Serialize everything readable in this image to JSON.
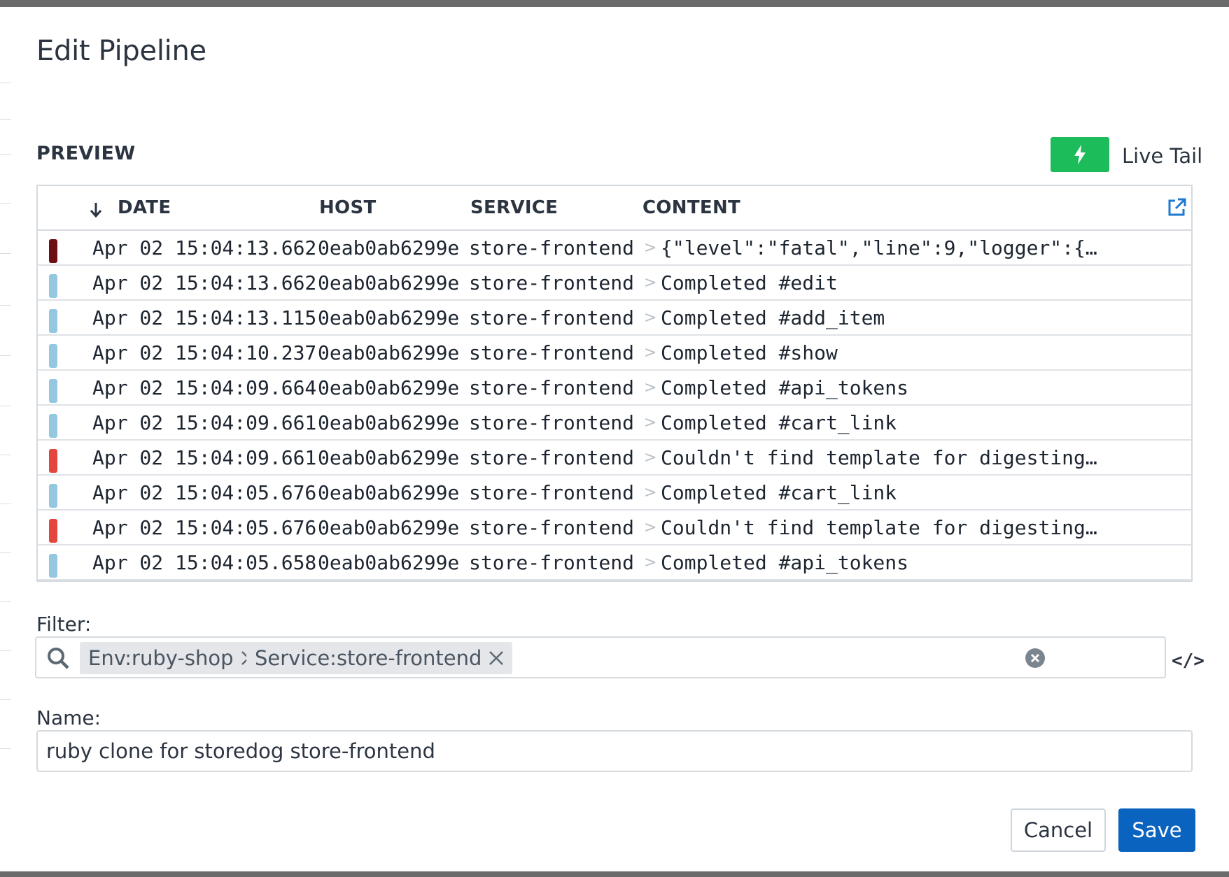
{
  "modal": {
    "title": "Edit Pipeline",
    "buttons": {
      "cancel": "Cancel",
      "save": "Save"
    }
  },
  "preview": {
    "label": "PREVIEW",
    "live_tail": {
      "label": "Live Tail",
      "icon": "bolt-icon",
      "color": "#1dbc5b"
    },
    "columns": [
      "DATE",
      "HOST",
      "SERVICE",
      "CONTENT"
    ],
    "sort": {
      "column": "DATE",
      "direction": "descending"
    },
    "rows": [
      {
        "status": "critical",
        "color": "#6e0f14",
        "date": "Apr 02 15:04:13.662",
        "host": "0eab0ab6299e",
        "service": "store-frontend",
        "content": "{\"level\":\"fatal\",\"line\":9,\"logger\":{…"
      },
      {
        "status": "info",
        "color": "#93c8e0",
        "date": "Apr 02 15:04:13.662",
        "host": "0eab0ab6299e",
        "service": "store-frontend",
        "content": "Completed #edit"
      },
      {
        "status": "info",
        "color": "#93c8e0",
        "date": "Apr 02 15:04:13.115",
        "host": "0eab0ab6299e",
        "service": "store-frontend",
        "content": "Completed #add_item"
      },
      {
        "status": "info",
        "color": "#93c8e0",
        "date": "Apr 02 15:04:10.237",
        "host": "0eab0ab6299e",
        "service": "store-frontend",
        "content": "Completed #show"
      },
      {
        "status": "info",
        "color": "#93c8e0",
        "date": "Apr 02 15:04:09.664",
        "host": "0eab0ab6299e",
        "service": "store-frontend",
        "content": "Completed #api_tokens"
      },
      {
        "status": "info",
        "color": "#93c8e0",
        "date": "Apr 02 15:04:09.661",
        "host": "0eab0ab6299e",
        "service": "store-frontend",
        "content": "Completed #cart_link"
      },
      {
        "status": "error",
        "color": "#e5453f",
        "date": "Apr 02 15:04:09.661",
        "host": "0eab0ab6299e",
        "service": "store-frontend",
        "content": "Couldn't find template for digesting…"
      },
      {
        "status": "info",
        "color": "#93c8e0",
        "date": "Apr 02 15:04:05.676",
        "host": "0eab0ab6299e",
        "service": "store-frontend",
        "content": "Completed #cart_link"
      },
      {
        "status": "error",
        "color": "#e5453f",
        "date": "Apr 02 15:04:05.676",
        "host": "0eab0ab6299e",
        "service": "store-frontend",
        "content": "Couldn't find template for digesting…"
      },
      {
        "status": "info",
        "color": "#93c8e0",
        "date": "Apr 02 15:04:05.658",
        "host": "0eab0ab6299e",
        "service": "store-frontend",
        "content": "Completed #api_tokens"
      }
    ]
  },
  "filter": {
    "label": "Filter:",
    "chips": [
      "Env:ruby-shop",
      "Service:store-frontend"
    ]
  },
  "name": {
    "label": "Name:",
    "value": "ruby clone for storedog store-frontend"
  },
  "colors": {
    "accent": "#0a63bf",
    "live_tail": "#1dbc5b",
    "link_icon": "#1f78d1"
  }
}
